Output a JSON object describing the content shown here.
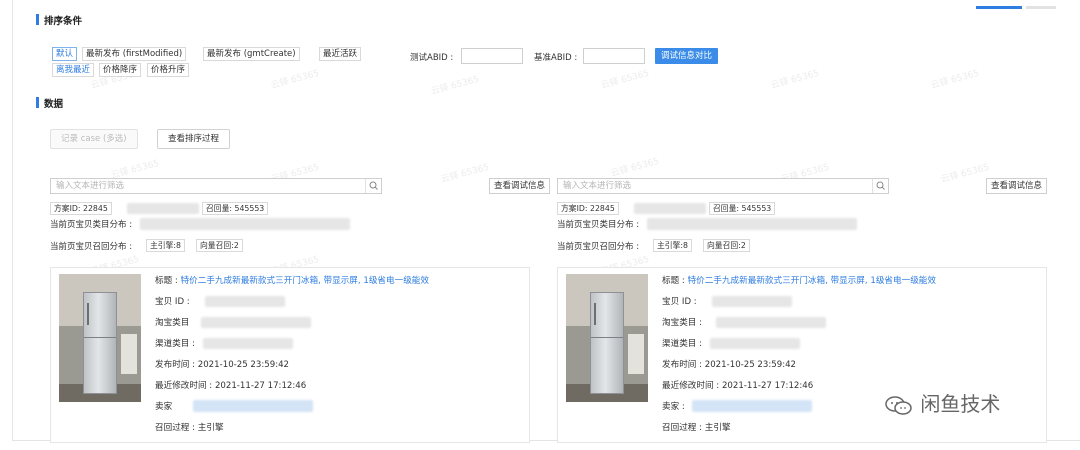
{
  "sections": {
    "sort_title": "排序条件",
    "data_title": "数据"
  },
  "sort_options": [
    {
      "label": "默认",
      "active": true
    },
    {
      "label": "最新发布 (firstModified)",
      "active": false
    },
    {
      "label": "最新发布 (gmtCreate)",
      "active": false
    },
    {
      "label": "最近活跃",
      "active": false
    },
    {
      "label": "离我最近",
      "active": false
    },
    {
      "label": "价格降序",
      "active": false
    },
    {
      "label": "价格升序",
      "active": false
    }
  ],
  "abid": {
    "test_label": "测试ABID :",
    "base_label": "基准ABID :",
    "compare_button": "调试信息对比"
  },
  "actions": {
    "record_case": "记录 case (多选)",
    "view_sort_process": "查看排序过程"
  },
  "watermark_text": "云铎 65365",
  "panels": [
    {
      "filter_placeholder": "输入文本进行筛选",
      "debug_button": "查看调试信息",
      "scheme_id": "方案ID: 22845",
      "recall_count": "召回量: 545553",
      "category_dist_label": "当前页宝贝类目分布 :",
      "recall_dist_label": "当前页宝贝召回分布 :",
      "recall_tags": [
        "主引擎:8",
        "向量召回:2"
      ],
      "item": {
        "title_label": "标题 :",
        "title_value": "特价二手九成新最新款式三开门冰箱, 带显示屏, 1级省电一级能效",
        "id_label": "宝贝 ID :",
        "taobao_cat_label": "淘宝类目",
        "channel_cat_label": "渠道类目 :",
        "publish_label": "发布时间 :",
        "publish_value": "2021-10-25 23:59:42",
        "modified_label": "最近修改时间 :",
        "modified_value": "2021-11-27 17:12:46",
        "seller_label": "卖家",
        "recall_label": "召回过程 :",
        "recall_value": "主引擎"
      }
    },
    {
      "filter_placeholder": "输入文本进行筛选",
      "debug_button": "查看调试信息",
      "scheme_id": "方案ID: 22845",
      "recall_count": "召回量: 545553",
      "category_dist_label": "当前页宝贝类目分布 :",
      "recall_dist_label": "当前页宝贝召回分布 :",
      "recall_tags": [
        "主引擎:8",
        "向量召回:2"
      ],
      "item": {
        "title_label": "标题 :",
        "title_value": "特价二手九成新最新款式三开门冰箱, 带显示屏, 1级省电一级能效",
        "id_label": "宝贝 ID :",
        "taobao_cat_label": "淘宝类目 :",
        "channel_cat_label": "渠道类目 :",
        "publish_label": "发布时间 :",
        "publish_value": "2021-10-25 23:59:42",
        "modified_label": "最近修改时间 :",
        "modified_value": "2021-11-27 17:12:46",
        "seller_label": "卖家 :",
        "recall_label": "召回过程 :",
        "recall_value": "主引擎"
      }
    }
  ],
  "brand": {
    "name": "闲鱼技术",
    "icon": "wechat-icon"
  }
}
